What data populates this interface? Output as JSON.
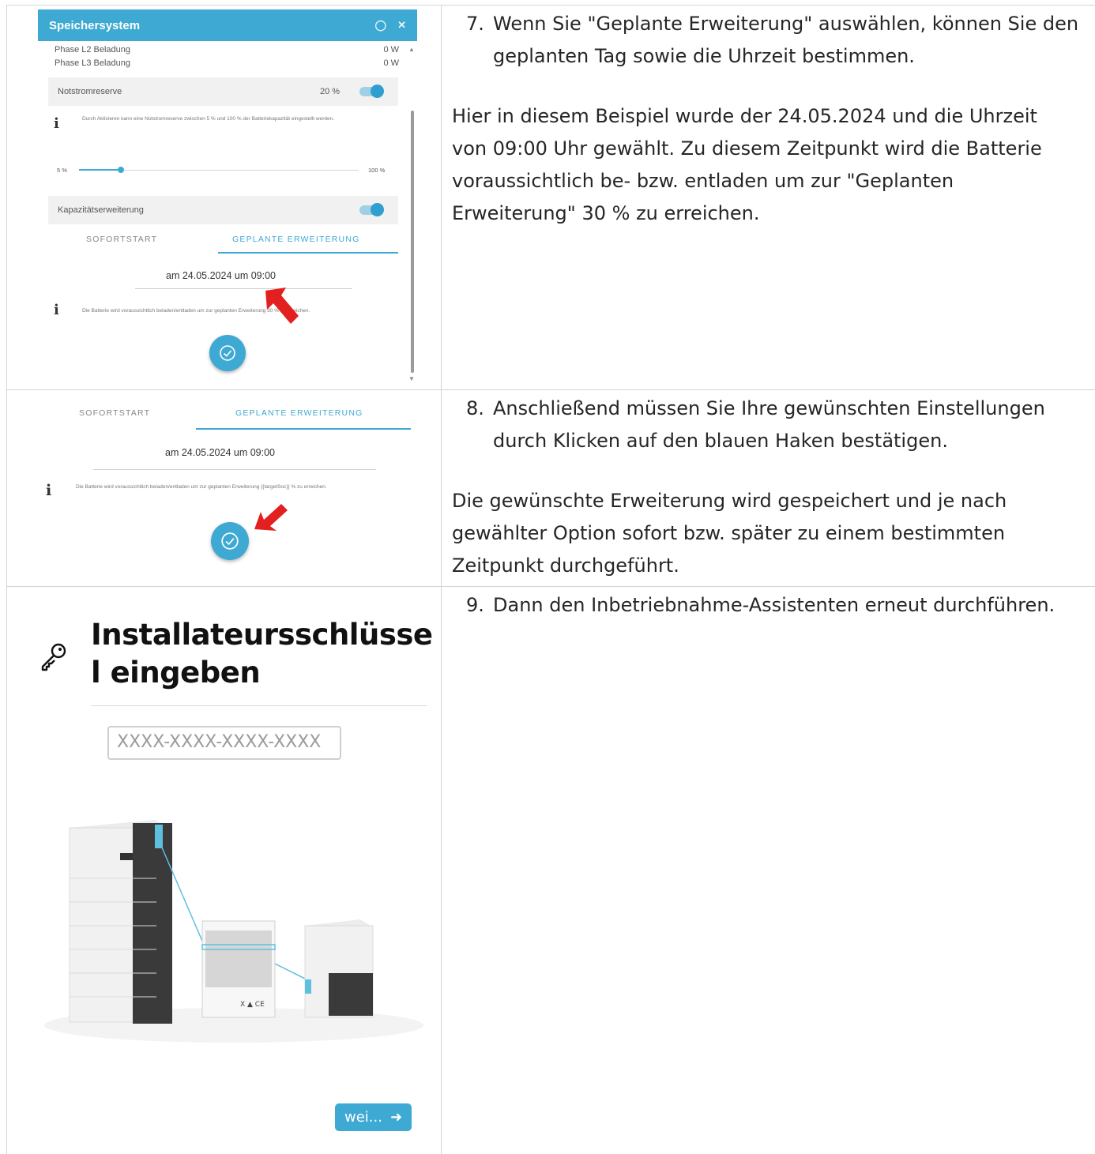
{
  "step7": {
    "number": "7.",
    "text": "Wenn Sie \"Geplante Erweiterung\" auswählen, können Sie den geplanten Tag sowie die Uhrzeit bestimmen.",
    "paragraph": "Hier in diesem Beispiel wurde der 24.05.2024 und die Uhrzeit von 09:00 Uhr gewählt. Zu diesem Zeitpunkt wird die Batterie voraussichtlich be- bzw. entladen um zur \"Geplanten Erweiterung\" 30 % zu erreichen."
  },
  "step8": {
    "number": "8.",
    "text": "Anschließend müssen Sie Ihre gewünschten Einstellungen durch Klicken auf den blauen Haken bestätigen.",
    "paragraph": "Die gewünschte Erweiterung wird gespeichert und je nach gewählter Option sofort bzw. später zu einem bestimmten Zeitpunkt durchgeführt."
  },
  "step9": {
    "number": "9.",
    "text": "Dann den Inbetriebnahme-Assistenten erneut durchführen."
  },
  "dialog": {
    "title": "Speichersystem",
    "phase_l2_label": "Phase L2 Beladung",
    "phase_l2_value": "0 W",
    "phase_l3_label": "Phase L3 Beladung",
    "phase_l3_value": "0 W",
    "notstrom_label": "Notstromreserve",
    "notstrom_value": "20 %",
    "notstrom_info": "Durch Aktivieren kann eine Notstromreserve zwischen 5 % und 100 % der Batteriekapazität eingestellt werden.",
    "slider_min": "5 %",
    "slider_max": "100 %",
    "slider_level": 0.15,
    "kapazitaet_label": "Kapazitätserweiterung",
    "tab_sofortstart": "SOFORTSTART",
    "tab_geplant": "GEPLANTE ERWEITERUNG",
    "date_text": "am 24.05.2024 um 09:00",
    "plan_info": "Die Batterie wird voraussichtlich beladen/entladen um zur geplanten Erweiterung 30 % zu erreichen."
  },
  "panel2": {
    "tab_sofortstart": "SOFORTSTART",
    "tab_geplant": "GEPLANTE ERWEITERUNG",
    "date_text": "am 24.05.2024 um 09:00",
    "plan_info": "Die Batterie wird voraussichtlich beladen/entladen um zur geplanten Erweiterung {{targetSoc}} % zu erreichen."
  },
  "installer": {
    "title": "Installateursschlüsse l eingeben",
    "placeholder": "XXXX-XXXX-XXXX-XXXX",
    "next_label": "wei..."
  },
  "icons": {
    "help": "help-icon",
    "close": "close-icon",
    "info": "info-icon",
    "check": "check-icon",
    "key": "key-icon",
    "arrow": "arrow-right-icon",
    "pointer": "red-arrow-pointer"
  },
  "colors": {
    "accent": "#3ea9d2",
    "pointer": "#e32020"
  }
}
